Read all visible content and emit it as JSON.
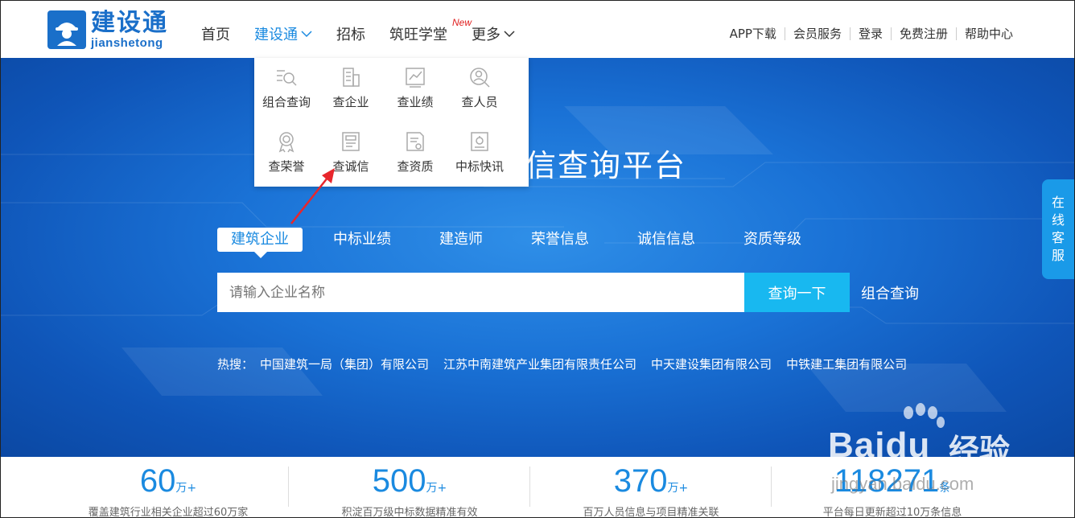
{
  "logo": {
    "cn": "建设通",
    "en": "jianshetong"
  },
  "nav": {
    "items": [
      {
        "label": "首页"
      },
      {
        "label": "建设通"
      },
      {
        "label": "招标"
      },
      {
        "label": "筑旺学堂",
        "badge": "New"
      },
      {
        "label": "更多"
      }
    ]
  },
  "top_links": [
    "APP下载",
    "会员服务",
    "登录",
    "免费注册",
    "帮助中心"
  ],
  "dropdown": {
    "items": [
      {
        "label": "组合查询",
        "icon": "combo-search-icon"
      },
      {
        "label": "查企业",
        "icon": "building-icon"
      },
      {
        "label": "查业绩",
        "icon": "chart-icon"
      },
      {
        "label": "查人员",
        "icon": "person-search-icon"
      },
      {
        "label": "查荣誉",
        "icon": "medal-icon"
      },
      {
        "label": "查诚信",
        "icon": "document-icon"
      },
      {
        "label": "查资质",
        "icon": "certificate-icon"
      },
      {
        "label": "中标快讯",
        "icon": "news-icon"
      }
    ]
  },
  "banner": {
    "title": "信查询平台"
  },
  "search_tabs": [
    "建筑企业",
    "中标业绩",
    "建造师",
    "荣誉信息",
    "诚信信息",
    "资质等级"
  ],
  "search": {
    "placeholder": "请输入企业名称",
    "button": "查询一下",
    "combo": "组合查询"
  },
  "hot": {
    "label": "热搜：",
    "items": [
      "中国建筑一局（集团）有限公司",
      "江苏中南建筑产业集团有限责任公司",
      "中天建设集团有限公司",
      "中铁建工集团有限公司"
    ]
  },
  "side_tab": [
    "在",
    "线",
    "客",
    "服"
  ],
  "stats": [
    {
      "num": "60",
      "unit": "万+",
      "desc": "覆盖建筑行业相关企业超过60万家"
    },
    {
      "num": "500",
      "unit": "万+",
      "desc": "积淀百万级中标数据精准有效"
    },
    {
      "num": "370",
      "unit": "万+",
      "desc": "百万人员信息与项目精准关联"
    },
    {
      "num": "118271",
      "unit": "条",
      "desc": "平台每日更新超过10万条信息"
    }
  ],
  "watermark": {
    "brand": "Bai",
    "brand2": "du",
    "cn": "经验",
    "url": "jingyan.baidu.com"
  },
  "colors": {
    "primary": "#1a8ae0",
    "button": "#18b8f0",
    "banner": "#1a72d6",
    "new": "#e02020"
  }
}
